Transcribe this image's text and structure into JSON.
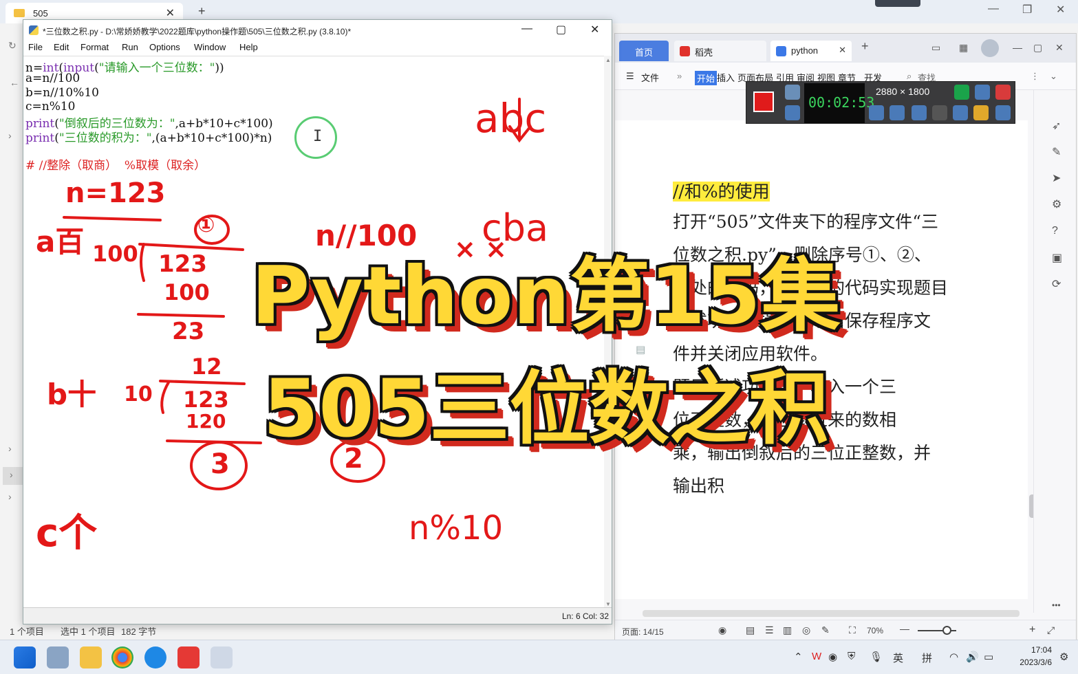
{
  "explorer": {
    "tab_title": "505",
    "status_items": "1 个项目",
    "status_selected": "选中 1 个项目",
    "status_size": "182 字节"
  },
  "idle": {
    "title": "*三位数之积.py - D:\\常娇娇教学\\2022题库\\python操作题\\505\\三位数之积.py (3.8.10)*",
    "menu": [
      "File",
      "Edit",
      "Format",
      "Run",
      "Options",
      "Window",
      "Help"
    ],
    "status": "Ln: 6  Col: 32",
    "code": [
      {
        "segs": [
          [
            "",
            "n="
          ],
          [
            "kw",
            "int"
          ],
          [
            "",
            "("
          ],
          [
            "kw",
            "input"
          ],
          [
            "",
            "("
          ],
          [
            "str",
            "\"请输入一个三位数：\""
          ],
          [
            "",
            "))"
          ]
        ]
      },
      {
        "segs": [
          [
            "",
            "a=n//100"
          ]
        ]
      },
      {
        "segs": [
          [
            "",
            "b=n//10%10"
          ]
        ]
      },
      {
        "segs": [
          [
            "",
            "c=n%10"
          ]
        ]
      },
      {
        "segs": [
          [
            "kw",
            "print"
          ],
          [
            "",
            "("
          ],
          [
            "str",
            "\"倒叙后的三位数为：\""
          ],
          [
            "",
            ",a+b*10+c*100)"
          ]
        ]
      },
      {
        "segs": [
          [
            "kw",
            "print"
          ],
          [
            "",
            "("
          ],
          [
            "str",
            "\"三位数的积为：\""
          ],
          [
            "",
            ",(a+b*10+c*100)*n)"
          ]
        ]
      },
      {
        "segs": [
          [
            "",
            ""
          ]
        ]
      },
      {
        "segs": [
          [
            "cmt",
            "# //整除（取商）  %取模（取余）"
          ]
        ]
      }
    ],
    "handwriting": {
      "n_eq": "n=123",
      "a_hundred": "a百",
      "divisor_100": "100",
      "quotient_1": "①",
      "dividend_123_a": "123",
      "sub_100": "100",
      "rem_23": "23",
      "b_ten": "b十",
      "divisor_10": "10",
      "quotient_12": "12",
      "dividend_123_b": "123",
      "sub_120": "120",
      "rem_3": "③",
      "c_unit": "c个",
      "floor_div": "n//100",
      "abc": "abc",
      "arrow": "↓",
      "cba": "cba",
      "circled_2": "②",
      "mod_10": "n%10"
    }
  },
  "wps": {
    "tab_home": "首页",
    "tab_docer": "稻壳",
    "tab_doc": "python",
    "ribbon": [
      "文件",
      "开始",
      "插入",
      "页面布局",
      "引用",
      "审阅",
      "视图",
      "章节",
      "开发"
    ],
    "search": "查找",
    "doc_lines": [
      {
        "text": "//和%的使用",
        "highlight": true
      },
      {
        "text": "打开“505”文件夹下的程序文件“三",
        "highlight": false
      },
      {
        "text": "位数之积.py”，删除序号①、②、",
        "highlight": false
      },
      {
        "text": "③处的代码，用正确的代码实现题目",
        "highlight": false
      },
      {
        "text": "所述功能。操作完成后保存程序文",
        "highlight": false
      },
      {
        "text": "件并关闭应用软件。",
        "highlight": false
      },
      {
        "text": "题目所述功能是：输入一个三",
        "highlight": false
      },
      {
        "text": "位正整数，将它倒过来的数相",
        "highlight": false
      },
      {
        "text": "乘，输出倒叙后的三位正整数，并",
        "highlight": false
      },
      {
        "text": "输出积",
        "highlight": false
      }
    ],
    "status_page": "页面: 14/15",
    "zoom": "70%",
    "zoom_level": 0.75
  },
  "recorder": {
    "timer": "00:02:53",
    "resolution": "2880 × 1800"
  },
  "overlay": {
    "line1": "Python第15集",
    "line2": "505三位数之积"
  },
  "taskbar": {
    "ime_lang": "英",
    "ime_mode": "拼",
    "time": "17:04",
    "date": "2023/3/6"
  },
  "colors": {
    "overlay_fill": "#ffd836",
    "overlay_shadow": "#d12a1e",
    "handwriting": "#e31818",
    "wps_accent": "#4b7de0"
  }
}
